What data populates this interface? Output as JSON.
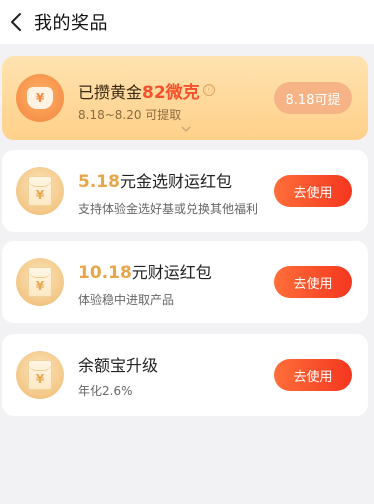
{
  "header": {
    "title": "我的奖品"
  },
  "gold": {
    "prefix": "已攒黄金",
    "amount": "82微克",
    "info_icon": "ⓘ",
    "date_range": "8.18~8.20 可提取",
    "button": "8.18可提",
    "icon_symbol": "¥"
  },
  "prizes": [
    {
      "amount": "5.18",
      "title_suffix": "元金选财运红包",
      "desc": "支持体验金选好基或兑换其他福利",
      "button": "去使用",
      "icon_symbol": "¥"
    },
    {
      "amount": "10.18",
      "title_suffix": "元财运红包",
      "desc": "体验稳中进取产品",
      "button": "去使用",
      "icon_symbol": "¥"
    },
    {
      "title": "余额宝升级",
      "desc": "年化2.6%",
      "button": "去使用",
      "icon_symbol": "¥"
    }
  ],
  "colors": {
    "accent_red": "#f4371f",
    "gold_amount": "#f5522c",
    "amount_gold": "#e8a64a"
  }
}
